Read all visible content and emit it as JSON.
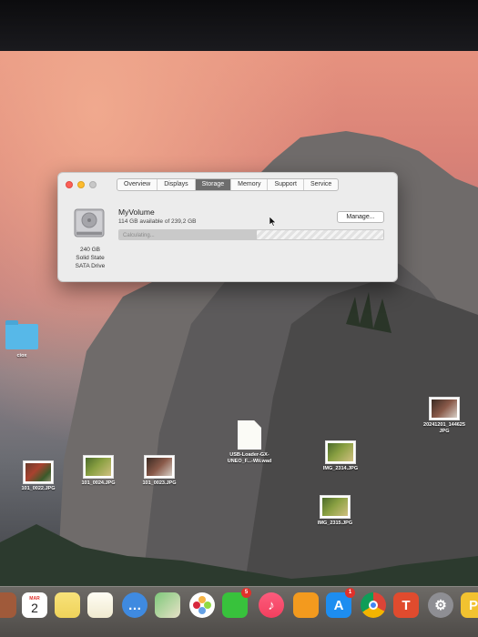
{
  "window": {
    "tabs": [
      {
        "label": "Overview",
        "active": false
      },
      {
        "label": "Displays",
        "active": false
      },
      {
        "label": "Storage",
        "active": true
      },
      {
        "label": "Memory",
        "active": false
      },
      {
        "label": "Support",
        "active": false
      },
      {
        "label": "Service",
        "active": false
      }
    ],
    "disk": {
      "size": "240 GB",
      "type": "Solid State",
      "interface": "SATA Drive"
    },
    "volume": {
      "name": "MyVolume",
      "available": "114 GB available of 239,2 GB",
      "status": "Calculating...",
      "used_fraction": 0.52
    },
    "manage_label": "Manage..."
  },
  "desktop": {
    "folder_label": "ciox",
    "files": {
      "f1": "101_0022.JPG",
      "f2": "101_0024.JPG",
      "f3": "101_0023.JPG",
      "wad_line1": "USB-Loader-GX-",
      "wad_line2": "UNEO_F...-Wii.wad",
      "img2314": "IMG_2314.JPG",
      "img2315": "IMG_2315.JPG",
      "photo_line1": "20241201_144625",
      "photo_line2": "JPG"
    }
  },
  "dock": {
    "calendar_month": "MAR",
    "calendar_day": "2",
    "facetime_badge": "5",
    "appstore_badge": "1"
  },
  "colors": {
    "active_tab": "#6d6d6d",
    "folder": "#57b8e8",
    "close": "#fc5f57",
    "minimize": "#fdbc2e"
  }
}
